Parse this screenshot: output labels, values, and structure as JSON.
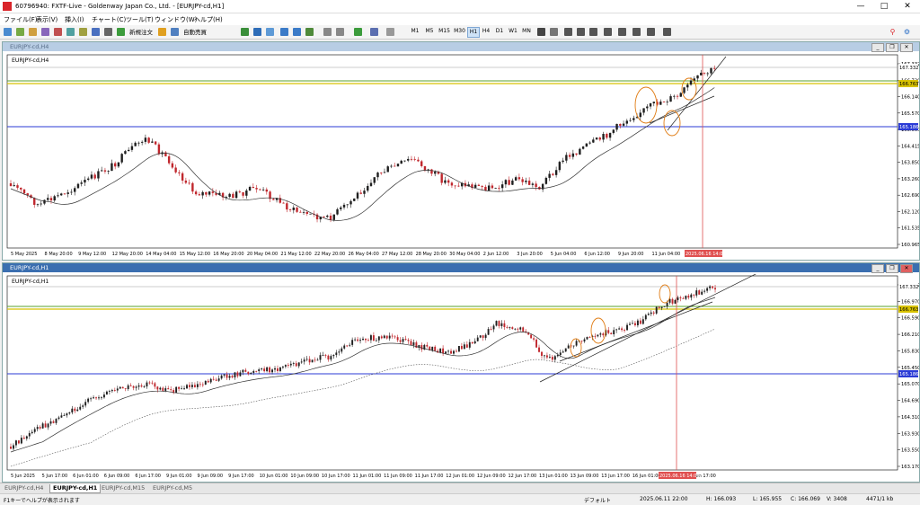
{
  "window": {
    "title": "60796940: FXTF-Live - Goldenway Japan Co., Ltd. - [EURJPY-cd,H1]",
    "min": "—",
    "max": "□",
    "close": "✕"
  },
  "menu": [
    "ファイル(F)",
    "表示(V)",
    "挿入(I)",
    "チャート(C)",
    "ツール(T)",
    "ウィンドウ(W)",
    "ヘルプ(H)"
  ],
  "toolbar": {
    "new_order": "新規注文",
    "auto_trade": "自動売買",
    "timeframes": [
      "M1",
      "M5",
      "M15",
      "M30",
      "H1",
      "H4",
      "D1",
      "W1",
      "MN"
    ],
    "active_timeframe": "H1"
  },
  "chart_h4": {
    "window_title": "EURJPY-cd,H4",
    "label": "EURJPY-cd,H4",
    "price_labels": [
      "167.332",
      "166.720",
      "166.140",
      "165.570",
      "165.000",
      "164.415",
      "163.850",
      "163.260",
      "162.690",
      "162.120",
      "161.535",
      "160.965"
    ],
    "price_tags": {
      "current": "167.332",
      "yellow": "166.763",
      "blue": "165.186"
    },
    "time_labels": [
      "5 May 2025",
      "8 May 20:00",
      "9 May 12:00",
      "12 May 20:00",
      "14 May 04:00",
      "15 May 12:00",
      "16 May 20:00",
      "20 May 04:00",
      "21 May 12:00",
      "22 May 20:00",
      "26 May 04:00",
      "27 May 12:00",
      "28 May 20:00",
      "30 May 04:00",
      "2 Jun 12:00",
      "3 Jun 20:00",
      "5 Jun 04:00",
      "6 Jun 12:00",
      "9 Jun 20:00",
      "11 Jun 04:00",
      "12 Jun 12:00"
    ],
    "vline_label": "2025.06.16 14:00"
  },
  "chart_h1": {
    "window_title": "EURJPY-cd,H1",
    "label": "EURJPY-cd,H1",
    "price_labels": [
      "167.332",
      "166.970",
      "166.590",
      "166.210",
      "165.830",
      "165.450",
      "165.070",
      "164.690",
      "164.310",
      "163.930",
      "163.550",
      "163.170"
    ],
    "price_tags": {
      "current": "167.332",
      "yellow": "166.763",
      "blue": "165.186"
    },
    "time_labels": [
      "5 Jun 2025",
      "5 Jun 17:00",
      "6 Jun 01:00",
      "6 Jun 09:00",
      "6 Jun 17:00",
      "9 Jun 01:00",
      "9 Jun 09:00",
      "9 Jun 17:00",
      "10 Jun 01:00",
      "10 Jun 09:00",
      "10 Jun 17:00",
      "11 Jun 01:00",
      "11 Jun 09:00",
      "11 Jun 17:00",
      "12 Jun 01:00",
      "12 Jun 09:00",
      "12 Jun 17:00",
      "13 Jun 01:00",
      "13 Jun 09:00",
      "13 Jun 17:00",
      "16 Jun 01:00",
      "16 Jun 09:00",
      "Jun 17:00"
    ],
    "vline_label": "2025.06.16 14:00"
  },
  "tabs": [
    "EURJPY-cd,H4",
    "EURJPY-cd,H1",
    "EURJPY-cd,M15",
    "EURJPY-cd,M5"
  ],
  "active_tab": 1,
  "status": {
    "help": "F1キーでヘルプが表示されます",
    "profile": "デフォルト",
    "datetime": "2025.06.11 22:00",
    "high": "H: 166.093",
    "low": "L: 165.955",
    "close": "C: 166.069",
    "volume": "V: 3408",
    "traffic": "4471/1 kb"
  },
  "colors": {
    "bull": "#1f1f1f",
    "bear": "#c0272d",
    "blue_line": "#2b3bd6",
    "yellow_line": "#d8c200",
    "green_line": "#5aa02c",
    "orange": "#e07b12",
    "vline": "#e05050",
    "ma": "#333333"
  }
}
